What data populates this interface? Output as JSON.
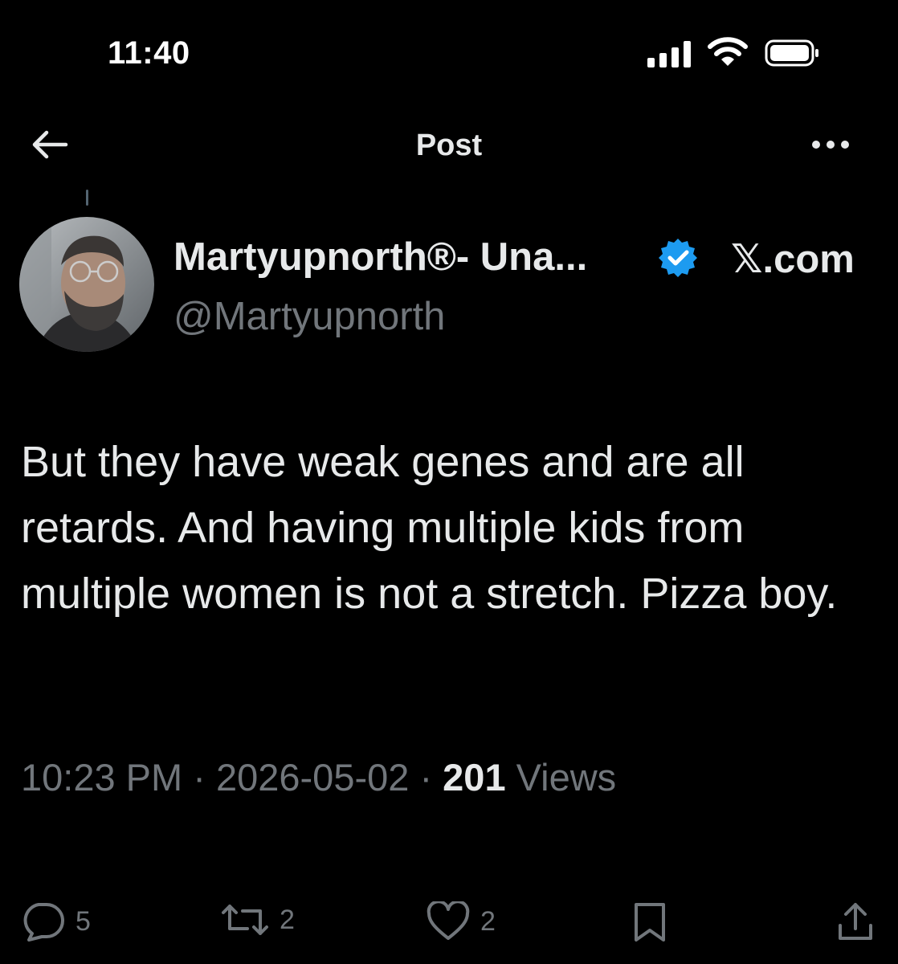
{
  "status_bar": {
    "time": "11:40"
  },
  "header": {
    "title": "Post"
  },
  "author": {
    "display_name": "Martyupnorth®- Una...",
    "handle": "@Martyupnorth",
    "link_text": "𝕏.com",
    "verified_color": "#1d9bf0"
  },
  "tweet": {
    "text": "But they have weak genes and are all retards.  And having multiple kids from multiple women is not a stretch. Pizza boy.",
    "time": "10:23 PM",
    "date": "2026-05-02",
    "views_count": "201",
    "views_label": "Views",
    "separator": "·"
  },
  "actions": {
    "replies": "5",
    "reposts": "2",
    "likes": "2"
  },
  "icons": [
    "back-arrow-icon",
    "more-icon",
    "verified-badge-icon",
    "reply-icon",
    "repost-icon",
    "like-icon",
    "bookmark-icon",
    "share-icon",
    "signal-icon",
    "wifi-icon",
    "battery-icon"
  ],
  "colors": {
    "background": "#000000",
    "text": "#e7e9ea",
    "secondary": "#71767b",
    "accent": "#1d9bf0"
  }
}
